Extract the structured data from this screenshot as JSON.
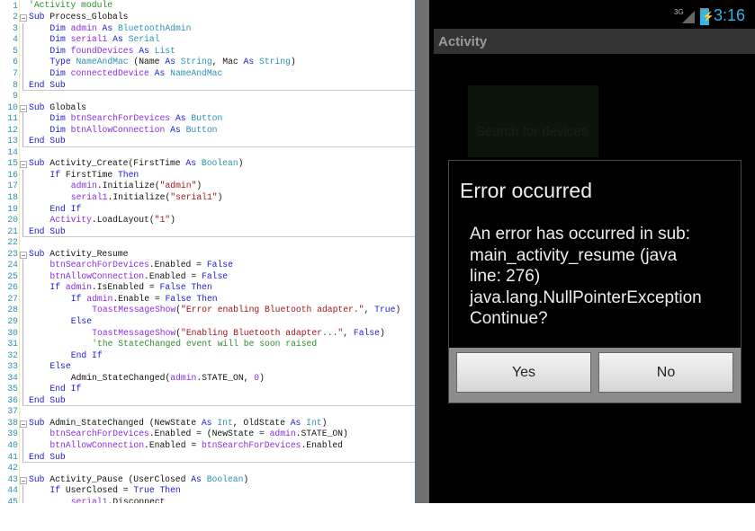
{
  "editor": {
    "lines": [
      {
        "n": "1",
        "indent": 0,
        "fold": "none",
        "tokens": [
          [
            "c",
            "'Activity module"
          ]
        ]
      },
      {
        "n": "2",
        "indent": 0,
        "fold": "start",
        "tokens": [
          [
            "k",
            "Sub"
          ],
          [
            "p",
            " Process_Globals"
          ]
        ]
      },
      {
        "n": "3",
        "indent": 1,
        "fold": "mid",
        "tokens": [
          [
            "k",
            "Dim "
          ],
          [
            "v",
            "admin "
          ],
          [
            "k",
            "As "
          ],
          [
            "t",
            "BluetoothAdmin"
          ]
        ]
      },
      {
        "n": "4",
        "indent": 1,
        "fold": "mid",
        "tokens": [
          [
            "k",
            "Dim "
          ],
          [
            "v",
            "serial1 "
          ],
          [
            "k",
            "As "
          ],
          [
            "t",
            "Serial"
          ]
        ]
      },
      {
        "n": "5",
        "indent": 1,
        "fold": "mid",
        "tokens": [
          [
            "k",
            "Dim "
          ],
          [
            "v",
            "foundDevices "
          ],
          [
            "k",
            "As "
          ],
          [
            "t",
            "List"
          ]
        ]
      },
      {
        "n": "6",
        "indent": 1,
        "fold": "mid",
        "tokens": [
          [
            "k",
            "Type "
          ],
          [
            "t",
            "NameAndMac "
          ],
          [
            "p",
            "(Name "
          ],
          [
            "k",
            "As "
          ],
          [
            "t",
            "String"
          ],
          [
            "p",
            ", Mac "
          ],
          [
            "k",
            "As "
          ],
          [
            "t",
            "String"
          ],
          [
            "p",
            ")"
          ]
        ]
      },
      {
        "n": "7",
        "indent": 1,
        "fold": "mid",
        "tokens": [
          [
            "k",
            "Dim "
          ],
          [
            "v",
            "connectedDevice "
          ],
          [
            "k",
            "As "
          ],
          [
            "t",
            "NameAndMac"
          ]
        ]
      },
      {
        "n": "8",
        "indent": 0,
        "fold": "end",
        "tokens": [
          [
            "k",
            "End Sub"
          ]
        ]
      },
      {
        "n": "9",
        "indent": 0,
        "fold": "none",
        "tokens": []
      },
      {
        "n": "10",
        "indent": 0,
        "fold": "start",
        "tokens": [
          [
            "k",
            "Sub"
          ],
          [
            "p",
            " Globals"
          ]
        ]
      },
      {
        "n": "11",
        "indent": 1,
        "fold": "mid",
        "tokens": [
          [
            "k",
            "Dim "
          ],
          [
            "v",
            "btnSearchForDevices "
          ],
          [
            "k",
            "As "
          ],
          [
            "t",
            "Button"
          ]
        ]
      },
      {
        "n": "12",
        "indent": 1,
        "fold": "mid",
        "tokens": [
          [
            "k",
            "Dim "
          ],
          [
            "v",
            "btnAllowConnection "
          ],
          [
            "k",
            "As "
          ],
          [
            "t",
            "Button"
          ]
        ]
      },
      {
        "n": "13",
        "indent": 0,
        "fold": "end",
        "tokens": [
          [
            "k",
            "End Sub"
          ]
        ]
      },
      {
        "n": "14",
        "indent": 0,
        "fold": "none",
        "tokens": []
      },
      {
        "n": "15",
        "indent": 0,
        "fold": "start",
        "tokens": [
          [
            "k",
            "Sub"
          ],
          [
            "p",
            " Activity_Create(FirstTime "
          ],
          [
            "k",
            "As "
          ],
          [
            "t",
            "Boolean"
          ],
          [
            "p",
            ")"
          ]
        ]
      },
      {
        "n": "16",
        "indent": 1,
        "fold": "mid",
        "tokens": [
          [
            "k",
            "If "
          ],
          [
            "p",
            "FirstTime "
          ],
          [
            "k",
            "Then"
          ]
        ]
      },
      {
        "n": "17",
        "indent": 2,
        "fold": "mid",
        "tokens": [
          [
            "v",
            "admin"
          ],
          [
            "p",
            ".Initialize("
          ],
          [
            "s",
            "\"admin\""
          ],
          [
            "p",
            ")"
          ]
        ]
      },
      {
        "n": "18",
        "indent": 2,
        "fold": "mid",
        "tokens": [
          [
            "v",
            "serial1"
          ],
          [
            "p",
            ".Initialize("
          ],
          [
            "s",
            "\"serial1\""
          ],
          [
            "p",
            ")"
          ]
        ]
      },
      {
        "n": "19",
        "indent": 1,
        "fold": "mid",
        "tokens": [
          [
            "k",
            "End If"
          ]
        ]
      },
      {
        "n": "20",
        "indent": 1,
        "fold": "mid",
        "tokens": [
          [
            "v",
            "Activity"
          ],
          [
            "p",
            ".LoadLayout("
          ],
          [
            "s",
            "\"1\""
          ],
          [
            "p",
            ")"
          ]
        ]
      },
      {
        "n": "21",
        "indent": 0,
        "fold": "end",
        "tokens": [
          [
            "k",
            "End Sub"
          ]
        ]
      },
      {
        "n": "22",
        "indent": 0,
        "fold": "none",
        "tokens": []
      },
      {
        "n": "23",
        "indent": 0,
        "fold": "start",
        "tokens": [
          [
            "k",
            "Sub"
          ],
          [
            "p",
            " Activity_Resume"
          ]
        ]
      },
      {
        "n": "24",
        "indent": 1,
        "fold": "mid",
        "tokens": [
          [
            "v",
            "btnSearchForDevices"
          ],
          [
            "p",
            ".Enabled = "
          ],
          [
            "k",
            "False"
          ]
        ]
      },
      {
        "n": "25",
        "indent": 1,
        "fold": "mid",
        "tokens": [
          [
            "v",
            "btnAllowConnection"
          ],
          [
            "p",
            ".Enabled = "
          ],
          [
            "k",
            "False"
          ]
        ]
      },
      {
        "n": "26",
        "indent": 1,
        "fold": "mid",
        "tokens": [
          [
            "k",
            "If "
          ],
          [
            "v",
            "admin"
          ],
          [
            "p",
            ".IsEnabled = "
          ],
          [
            "k",
            "False Then"
          ]
        ]
      },
      {
        "n": "27",
        "indent": 2,
        "fold": "mid",
        "tokens": [
          [
            "k",
            "If "
          ],
          [
            "v",
            "admin"
          ],
          [
            "p",
            ".Enable = "
          ],
          [
            "k",
            "False Then"
          ]
        ]
      },
      {
        "n": "28",
        "indent": 3,
        "fold": "mid",
        "tokens": [
          [
            "v",
            "ToastMessageShow"
          ],
          [
            "p",
            "("
          ],
          [
            "s",
            "\"Error enabling Bluetooth adapter.\""
          ],
          [
            "p",
            ", "
          ],
          [
            "k",
            "True"
          ],
          [
            "p",
            ")"
          ]
        ]
      },
      {
        "n": "29",
        "indent": 2,
        "fold": "mid",
        "tokens": [
          [
            "k",
            "Else"
          ]
        ]
      },
      {
        "n": "30",
        "indent": 3,
        "fold": "mid",
        "tokens": [
          [
            "v",
            "ToastMessageShow"
          ],
          [
            "p",
            "("
          ],
          [
            "s",
            "\"Enabling Bluetooth adapter...\""
          ],
          [
            "p",
            ", "
          ],
          [
            "k",
            "False"
          ],
          [
            "p",
            ")"
          ]
        ]
      },
      {
        "n": "31",
        "indent": 3,
        "fold": "mid",
        "tokens": [
          [
            "c",
            "'the StateChanged event will be soon raised"
          ]
        ]
      },
      {
        "n": "32",
        "indent": 2,
        "fold": "mid",
        "tokens": [
          [
            "k",
            "End If"
          ]
        ]
      },
      {
        "n": "33",
        "indent": 1,
        "fold": "mid",
        "tokens": [
          [
            "k",
            "Else"
          ]
        ]
      },
      {
        "n": "34",
        "indent": 2,
        "fold": "mid",
        "tokens": [
          [
            "p",
            "Admin_StateChanged("
          ],
          [
            "v",
            "admin"
          ],
          [
            "p",
            ".STATE_ON, "
          ],
          [
            "n",
            "0"
          ],
          [
            "p",
            ")"
          ]
        ]
      },
      {
        "n": "35",
        "indent": 1,
        "fold": "mid",
        "tokens": [
          [
            "k",
            "End If"
          ]
        ]
      },
      {
        "n": "36",
        "indent": 0,
        "fold": "end",
        "tokens": [
          [
            "k",
            "End Sub"
          ]
        ]
      },
      {
        "n": "37",
        "indent": 0,
        "fold": "none",
        "tokens": []
      },
      {
        "n": "38",
        "indent": 0,
        "fold": "start",
        "tokens": [
          [
            "k",
            "Sub"
          ],
          [
            "p",
            " Admin_StateChanged (NewState "
          ],
          [
            "k",
            "As "
          ],
          [
            "t",
            "Int"
          ],
          [
            "p",
            ", OldState "
          ],
          [
            "k",
            "As "
          ],
          [
            "t",
            "Int"
          ],
          [
            "p",
            ")"
          ]
        ]
      },
      {
        "n": "39",
        "indent": 1,
        "fold": "mid",
        "tokens": [
          [
            "v",
            "btnSearchForDevices"
          ],
          [
            "p",
            ".Enabled = (NewState = "
          ],
          [
            "v",
            "admin"
          ],
          [
            "p",
            ".STATE_ON)"
          ]
        ]
      },
      {
        "n": "40",
        "indent": 1,
        "fold": "mid",
        "tokens": [
          [
            "v",
            "btnAllowConnection"
          ],
          [
            "p",
            ".Enabled = "
          ],
          [
            "v",
            "btnSearchForDevices"
          ],
          [
            "p",
            ".Enabled"
          ]
        ]
      },
      {
        "n": "41",
        "indent": 0,
        "fold": "end",
        "tokens": [
          [
            "k",
            "End Sub"
          ]
        ]
      },
      {
        "n": "42",
        "indent": 0,
        "fold": "none",
        "tokens": []
      },
      {
        "n": "43",
        "indent": 0,
        "fold": "start",
        "tokens": [
          [
            "k",
            "Sub"
          ],
          [
            "p",
            " Activity_Pause (UserClosed "
          ],
          [
            "k",
            "As "
          ],
          [
            "t",
            "Boolean"
          ],
          [
            "p",
            ")"
          ]
        ]
      },
      {
        "n": "44",
        "indent": 1,
        "fold": "mid",
        "tokens": [
          [
            "k",
            "If "
          ],
          [
            "p",
            "UserClosed = "
          ],
          [
            "k",
            "True Then"
          ]
        ]
      },
      {
        "n": "45",
        "indent": 2,
        "fold": "mid",
        "tokens": [
          [
            "v",
            "serial1"
          ],
          [
            "p",
            ".Disconnect"
          ]
        ]
      }
    ]
  },
  "phone": {
    "status": {
      "network": "3G",
      "time": "3:16",
      "battery_icon": "battery-charging-icon",
      "accent": "#33b5e5"
    },
    "title": "Activity",
    "search_button": "Search for devices",
    "dialog": {
      "title": "Error occurred",
      "message_lines": [
        "An error has occurred in sub:",
        "main_activity_resume (java",
        "line: 276)",
        "java.lang.NullPointerException",
        "Continue?"
      ],
      "yes": "Yes",
      "no": "No"
    }
  }
}
